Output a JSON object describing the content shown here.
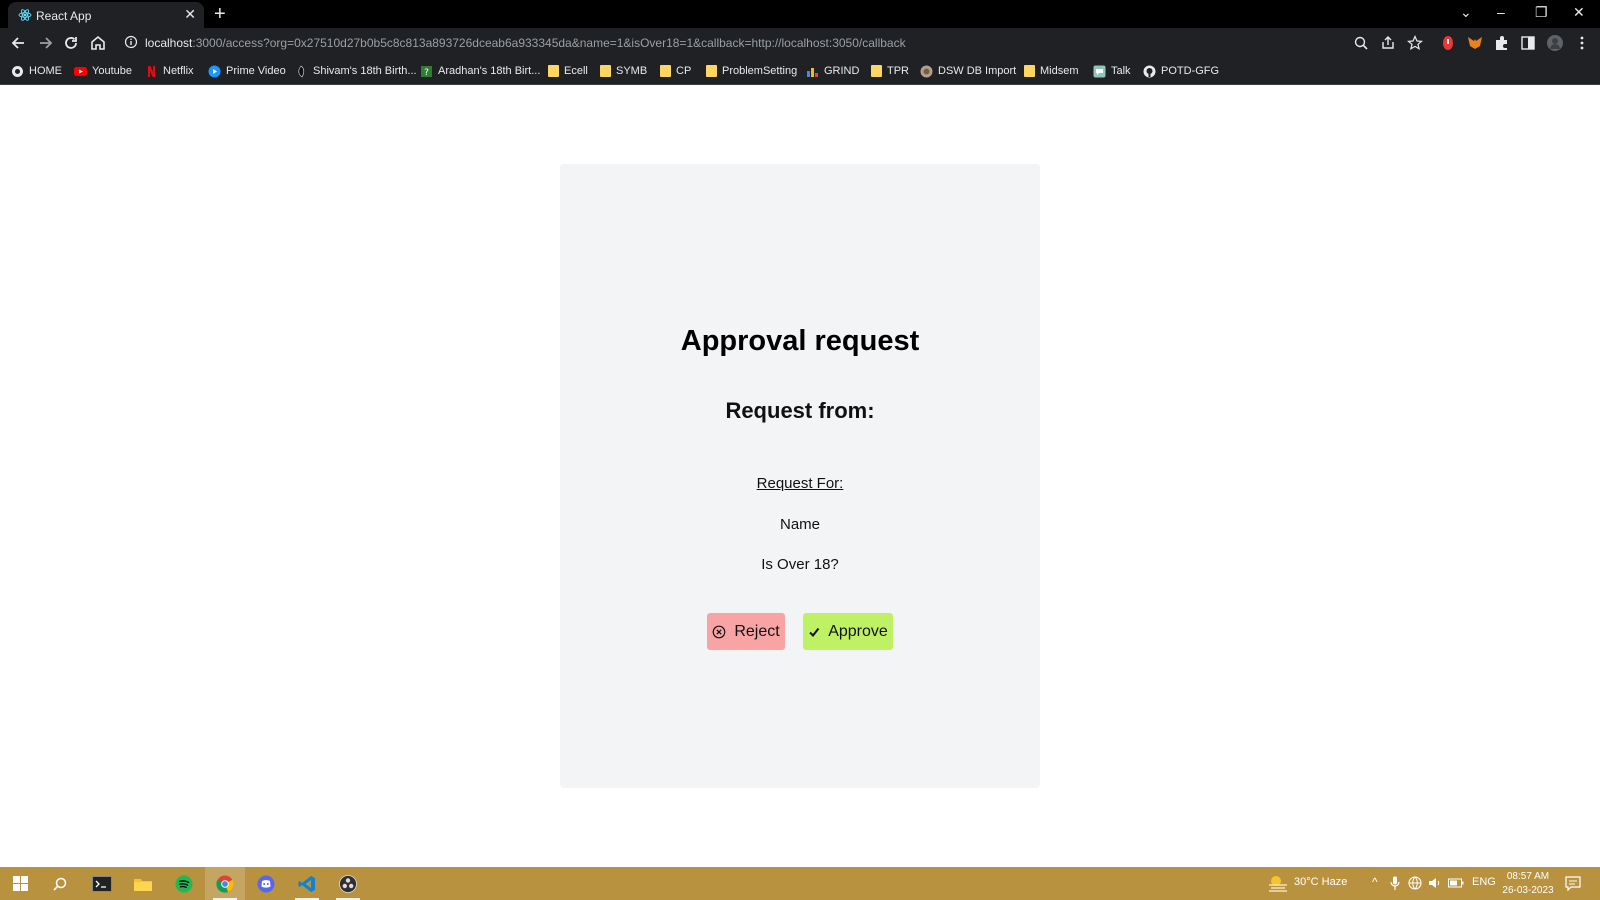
{
  "browser": {
    "tab_title": "React App",
    "url_host": "localhost",
    "url_rest": ":3000/access?org=0x27510d27b0b5c8c813a893726dceab6a933345da&name=1&isOver18=1&callback=http://localhost:3050/callback",
    "bookmarks": [
      {
        "label": "HOME",
        "icon": "globe-icon"
      },
      {
        "label": "Youtube",
        "icon": "youtube-icon"
      },
      {
        "label": "Netflix",
        "icon": "netflix-icon"
      },
      {
        "label": "Prime Video",
        "icon": "prime-video-icon"
      },
      {
        "label": "Shivam's 18th Birth...",
        "icon": "bookmark-icon"
      },
      {
        "label": "Aradhan's 18th Birt...",
        "icon": "bookmark-icon"
      },
      {
        "label": "Ecell",
        "icon": "folder-icon"
      },
      {
        "label": "SYMB",
        "icon": "folder-icon"
      },
      {
        "label": "CP",
        "icon": "folder-icon"
      },
      {
        "label": "ProblemSetting",
        "icon": "folder-icon"
      },
      {
        "label": "GRIND",
        "icon": "chart-icon"
      },
      {
        "label": "TPR",
        "icon": "folder-icon"
      },
      {
        "label": "DSW DB Import",
        "icon": "bookmark-icon"
      },
      {
        "label": "Midsem",
        "icon": "folder-icon"
      },
      {
        "label": "Talk",
        "icon": "chat-icon"
      },
      {
        "label": "POTD-GFG",
        "icon": "github-icon"
      }
    ]
  },
  "page": {
    "title": "Approval request",
    "subtitle": "Request from:",
    "request_for_label": "Request For:",
    "items": [
      "Name",
      "Is Over 18?"
    ],
    "reject_label": "Reject",
    "approve_label": "Approve"
  },
  "taskbar": {
    "weather": "30°C  Haze",
    "language": "ENG",
    "time": "08:57 AM",
    "date": "26-03-2023"
  },
  "colors": {
    "card_bg": "#f3f4f6",
    "reject_bg": "#f8a4a4",
    "approve_bg": "#bef264",
    "taskbar_bg": "#b8923f"
  }
}
